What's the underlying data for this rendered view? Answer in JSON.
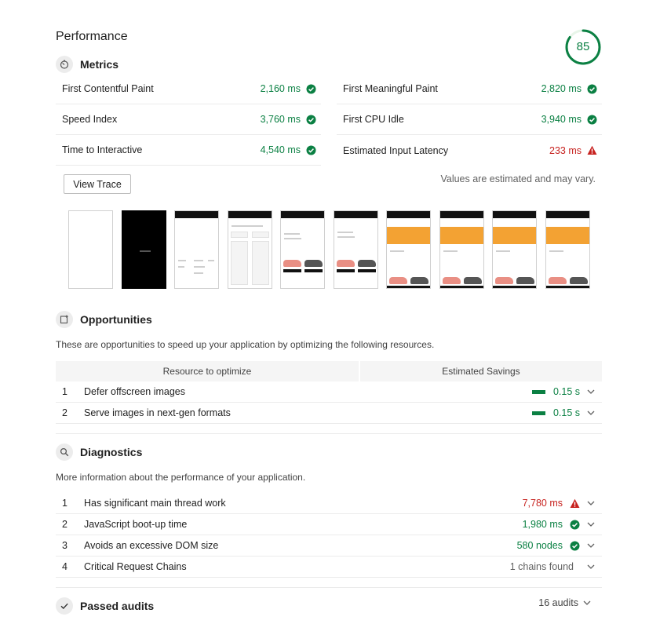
{
  "performance": {
    "title": "Performance",
    "score": 85,
    "score_color": "#0b8043"
  },
  "metrics": {
    "title": "Metrics",
    "icon": "timer-icon",
    "items": [
      {
        "label": "First Contentful Paint",
        "value": "2,160 ms",
        "status": "pass"
      },
      {
        "label": "First Meaningful Paint",
        "value": "2,820 ms",
        "status": "pass"
      },
      {
        "label": "Speed Index",
        "value": "3,760 ms",
        "status": "pass"
      },
      {
        "label": "First CPU Idle",
        "value": "3,940 ms",
        "status": "pass"
      },
      {
        "label": "Time to Interactive",
        "value": "4,540 ms",
        "status": "pass"
      },
      {
        "label": "Estimated Input Latency",
        "value": "233 ms",
        "status": "fail"
      }
    ],
    "view_trace_label": "View Trace",
    "estimate_note": "Values are estimated and may vary."
  },
  "filmstrip": {
    "frames": [
      "blank",
      "black",
      "header-list",
      "skeleton",
      "shoes",
      "shoes",
      "banner-shoes",
      "banner-shoes",
      "banner-shoes",
      "banner-shoes"
    ]
  },
  "opportunities": {
    "title": "Opportunities",
    "icon": "opportunity-icon",
    "description": "These are opportunities to speed up your application by optimizing the following resources.",
    "col_resource": "Resource to optimize",
    "col_savings": "Estimated Savings",
    "rows": [
      {
        "num": "1",
        "title": "Defer offscreen images",
        "savings": "0.15 s"
      },
      {
        "num": "2",
        "title": "Serve images in next-gen formats",
        "savings": "0.15 s"
      }
    ]
  },
  "diagnostics": {
    "title": "Diagnostics",
    "icon": "search-icon",
    "description": "More information about the performance of your application.",
    "rows": [
      {
        "num": "1",
        "title": "Has significant main thread work",
        "value": "7,780 ms",
        "status": "fail"
      },
      {
        "num": "2",
        "title": "JavaScript boot-up time",
        "value": "1,980 ms",
        "status": "pass"
      },
      {
        "num": "3",
        "title": "Avoids an excessive DOM size",
        "value": "580 nodes",
        "status": "pass"
      },
      {
        "num": "4",
        "title": "Critical Request Chains",
        "value": "1 chains found",
        "status": "info"
      }
    ]
  },
  "passed": {
    "title": "Passed audits",
    "icon": "check-icon",
    "count": "16 audits"
  },
  "colors": {
    "pass": "#0b8043",
    "fail": "#c7221f"
  }
}
